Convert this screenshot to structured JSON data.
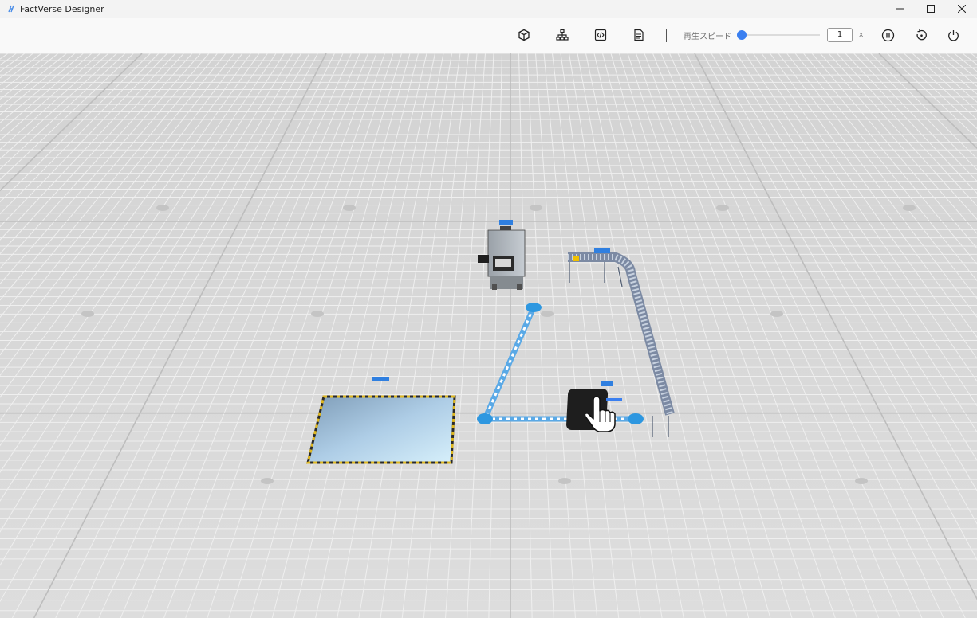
{
  "window": {
    "title": "FactVerse Designer"
  },
  "window_controls": [
    "minimize-icon",
    "maximize-icon",
    "close-icon"
  ],
  "toolbar": {
    "tools": [
      {
        "name": "model-library",
        "icon": "cube-icon"
      },
      {
        "name": "scene-hierarchy",
        "icon": "hierarchy-icon"
      },
      {
        "name": "logic-editor",
        "icon": "code-icon"
      },
      {
        "name": "document",
        "icon": "document-icon"
      }
    ],
    "playback": {
      "speed_label": "再生スピード",
      "speed_value": "1",
      "speed_unit": "x",
      "slider_fraction": 0.0
    },
    "controls": [
      {
        "name": "pause",
        "icon": "pause-icon"
      },
      {
        "name": "reset",
        "icon": "reset-icon"
      },
      {
        "name": "power",
        "icon": "power-icon"
      }
    ]
  },
  "scene": {
    "objects": [
      {
        "name": "machine",
        "label": ""
      },
      {
        "name": "conveyor",
        "label": ""
      },
      {
        "name": "storage-area",
        "label": ""
      },
      {
        "name": "agv",
        "label": ""
      }
    ],
    "path_color": "#5aa9e6",
    "selection_color": "#2f7fe0"
  }
}
